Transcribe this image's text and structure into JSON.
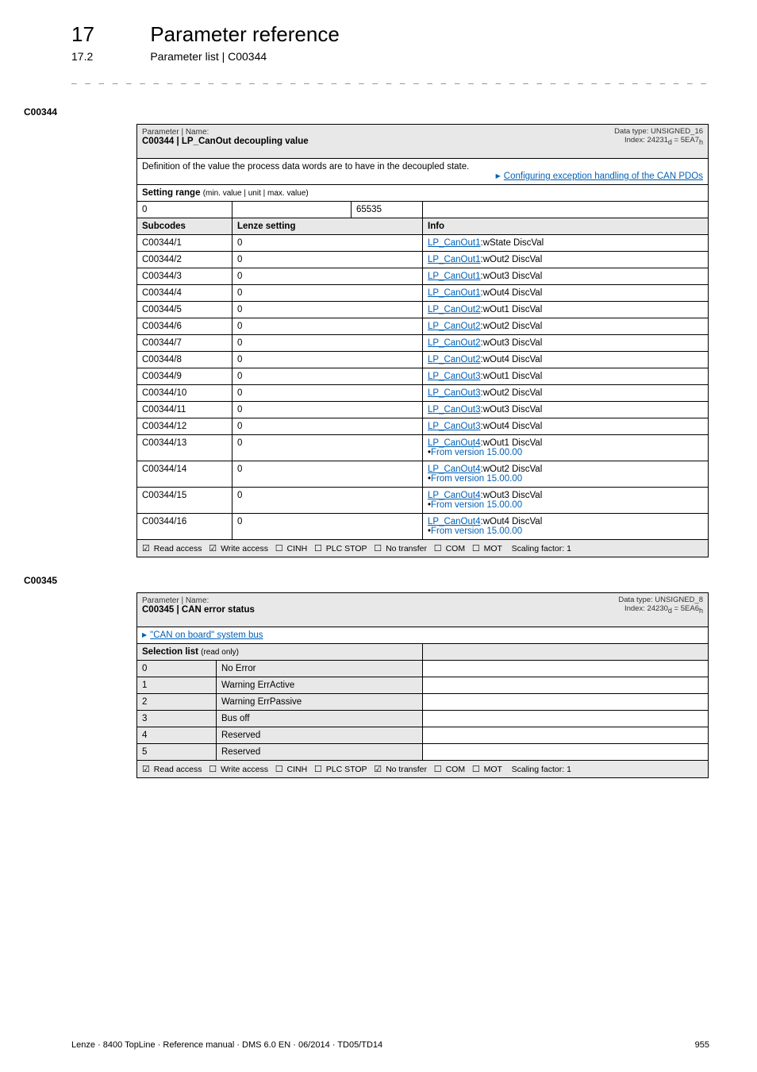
{
  "header": {
    "chapter_number": "17",
    "chapter_title": "Parameter reference",
    "section_number": "17.2",
    "section_title": "Parameter list | C00344"
  },
  "dashline": "_ _ _ _ _ _ _ _ _ _ _ _ _ _ _ _ _ _ _ _ _ _ _ _ _ _ _ _ _ _ _ _ _ _ _ _ _ _ _ _ _ _ _ _ _ _ _ _ _ _ _ _ _ _ _ _ _ _ _ _ _ _ _ _",
  "anchors": {
    "a1": "C00344",
    "a2": "C00345"
  },
  "t1": {
    "paramlabel": "Parameter | Name:",
    "name": "C00344 | LP_CanOut decoupling value",
    "datatype_line1": "Data type: UNSIGNED_16",
    "datatype_line2_prefix": "Index: 24231",
    "datatype_line2_suffix": " = 5EA7",
    "definition": "Definition of the value the process data words are to have in the decoupled state.",
    "deflink": "Configuring exception handling of the CAN PDOs",
    "range_label": "Setting range (min. value | unit | max. value)",
    "range_min": "0",
    "range_max": "65535",
    "col_sub": "Subcodes",
    "col_set": "Lenze setting",
    "col_info": "Info",
    "rows": [
      {
        "sub": "C00344/1",
        "set": "0",
        "info": [
          {
            "link": "LP_CanOut1",
            "tail": ":wState DiscVal"
          }
        ]
      },
      {
        "sub": "C00344/2",
        "set": "0",
        "info": [
          {
            "link": "LP_CanOut1",
            "tail": ":wOut2 DiscVal"
          }
        ]
      },
      {
        "sub": "C00344/3",
        "set": "0",
        "info": [
          {
            "link": "LP_CanOut1",
            "tail": ":wOut3 DiscVal"
          }
        ]
      },
      {
        "sub": "C00344/4",
        "set": "0",
        "info": [
          {
            "link": "LP_CanOut1",
            "tail": ":wOut4 DiscVal"
          }
        ]
      },
      {
        "sub": "C00344/5",
        "set": "0",
        "info": [
          {
            "link": "LP_CanOut2",
            "tail": ":wOut1 DiscVal"
          }
        ]
      },
      {
        "sub": "C00344/6",
        "set": "0",
        "info": [
          {
            "link": "LP_CanOut2",
            "tail": ":wOut2 DiscVal"
          }
        ]
      },
      {
        "sub": "C00344/7",
        "set": "0",
        "info": [
          {
            "link": "LP_CanOut2",
            "tail": ":wOut3 DiscVal"
          }
        ]
      },
      {
        "sub": "C00344/8",
        "set": "0",
        "info": [
          {
            "link": "LP_CanOut2",
            "tail": ":wOut4 DiscVal"
          }
        ]
      },
      {
        "sub": "C00344/9",
        "set": "0",
        "info": [
          {
            "link": "LP_CanOut3",
            "tail": ":wOut1 DiscVal"
          }
        ]
      },
      {
        "sub": "C00344/10",
        "set": "0",
        "info": [
          {
            "link": "LP_CanOut3",
            "tail": ":wOut2 DiscVal"
          }
        ]
      },
      {
        "sub": "C00344/11",
        "set": "0",
        "info": [
          {
            "link": "LP_CanOut3",
            "tail": ":wOut3 DiscVal"
          }
        ]
      },
      {
        "sub": "C00344/12",
        "set": "0",
        "info": [
          {
            "link": "LP_CanOut3",
            "tail": ":wOut4 DiscVal"
          }
        ]
      },
      {
        "sub": "C00344/13",
        "set": "0",
        "info": [
          {
            "link": "LP_CanOut4",
            "tail": ":wOut1 DiscVal"
          },
          {
            "note": "From version 15.00.00"
          }
        ]
      },
      {
        "sub": "C00344/14",
        "set": "0",
        "info": [
          {
            "link": "LP_CanOut4",
            "tail": ":wOut2 DiscVal"
          },
          {
            "note": "From version 15.00.00"
          }
        ]
      },
      {
        "sub": "C00344/15",
        "set": "0",
        "info": [
          {
            "link": "LP_CanOut4",
            "tail": ":wOut3 DiscVal"
          },
          {
            "note": "From version 15.00.00"
          }
        ]
      },
      {
        "sub": "C00344/16",
        "set": "0",
        "info": [
          {
            "link": "LP_CanOut4",
            "tail": ":wOut4 DiscVal"
          },
          {
            "note": "From version 15.00.00"
          }
        ]
      }
    ],
    "flags": {
      "read": {
        "sym": "☑",
        "label": "Read access"
      },
      "write": {
        "sym": "☑",
        "label": "Write access"
      },
      "cinh": {
        "sym": "☐",
        "label": "CINH"
      },
      "plc": {
        "sym": "☐",
        "label": "PLC STOP"
      },
      "notr": {
        "sym": "☐",
        "label": "No transfer"
      },
      "com": {
        "sym": "☐",
        "label": "COM"
      },
      "mot": {
        "sym": "☐",
        "label": "MOT"
      },
      "scaling": "Scaling factor: 1"
    }
  },
  "t2": {
    "paramlabel": "Parameter | Name:",
    "name": "C00345 | CAN error status",
    "datatype_line1": "Data type: UNSIGNED_8",
    "datatype_line2_prefix": "Index: 24230",
    "datatype_line2_suffix": " = 5EA6",
    "toplink": "\"CAN on board\" system bus",
    "sel_label": "Selection list (read only)",
    "rows": [
      {
        "n": "0",
        "t": "No Error"
      },
      {
        "n": "1",
        "t": "Warning ErrActive"
      },
      {
        "n": "2",
        "t": "Warning ErrPassive"
      },
      {
        "n": "3",
        "t": "Bus off"
      },
      {
        "n": "4",
        "t": "Reserved"
      },
      {
        "n": "5",
        "t": "Reserved"
      }
    ],
    "flags": {
      "read": {
        "sym": "☑",
        "label": "Read access"
      },
      "write": {
        "sym": "☐",
        "label": "Write access"
      },
      "cinh": {
        "sym": "☐",
        "label": "CINH"
      },
      "plc": {
        "sym": "☐",
        "label": "PLC STOP"
      },
      "notr": {
        "sym": "☑",
        "label": "No transfer"
      },
      "com": {
        "sym": "☐",
        "label": "COM"
      },
      "mot": {
        "sym": "☐",
        "label": "MOT"
      },
      "scaling": "Scaling factor: 1"
    }
  },
  "footer": {
    "left": "Lenze · 8400 TopLine · Reference manual · DMS 6.0 EN · 06/2014 · TD05/TD14",
    "right": "955"
  }
}
